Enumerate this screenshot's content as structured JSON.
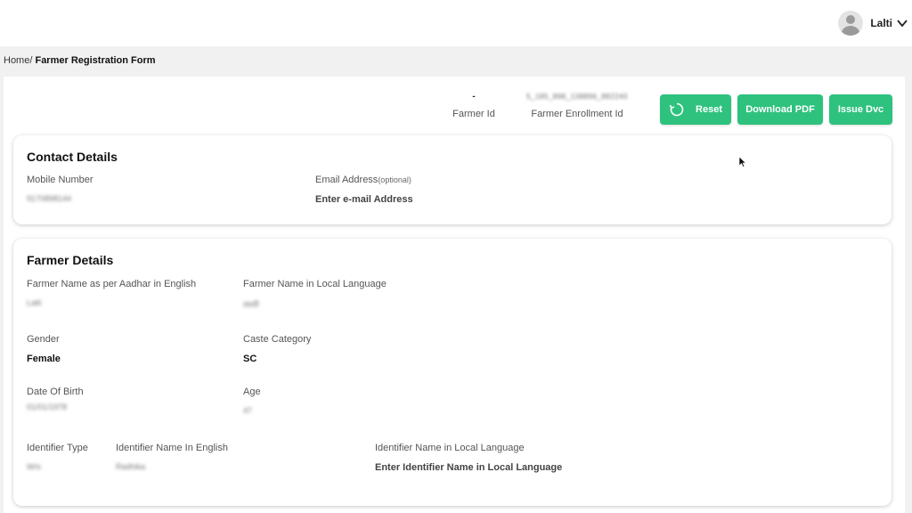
{
  "header": {
    "user_name": "Lalti"
  },
  "breadcrumb": {
    "home": "Home/",
    "current": "Farmer Registration Form"
  },
  "ids": {
    "farmer_id_value": "-",
    "farmer_id_label": "Farmer Id",
    "enrollment_id_value": "5_185_898_138896_882240",
    "enrollment_id_label": "Farmer Enrollment Id"
  },
  "actions": {
    "reset": "Reset",
    "download_pdf": "Download PDF",
    "issue_dvc": "Issue Dvc"
  },
  "contact": {
    "title": "Contact Details",
    "mobile_label": "Mobile Number",
    "mobile_value": "9170898144",
    "email_label": "Email Address",
    "email_optional": "(optional)",
    "email_placeholder": "Enter e-mail Address"
  },
  "farmer": {
    "title": "Farmer Details",
    "name_en_label": "Farmer Name as per Aadhar in English",
    "name_en_value": "Lalti",
    "name_local_label": "Farmer Name in Local Language",
    "name_local_value": "लल्ती",
    "gender_label": "Gender",
    "gender_value": "Female",
    "caste_label": "Caste Category",
    "caste_value": "SC",
    "dob_label": "Date Of Birth",
    "dob_value": "01/01/1978",
    "age_label": "Age",
    "age_value": "47",
    "identifier_type_label": "Identifier Type",
    "identifier_type_value": "W/o",
    "identifier_name_en_label": "Identifier Name In English",
    "identifier_name_en_value": "Radhika",
    "identifier_name_local_label": "Identifier Name in Local Language",
    "identifier_name_local_placeholder": "Enter Identifier Name in Local Language"
  },
  "icons": {
    "avatar": "user-avatar-icon",
    "chevron": "chevron-down-icon",
    "reset": "refresh-icon",
    "cursor": "mouse-pointer-icon"
  },
  "colors": {
    "accent": "#2ec27e",
    "background": "#f1f1f1"
  }
}
